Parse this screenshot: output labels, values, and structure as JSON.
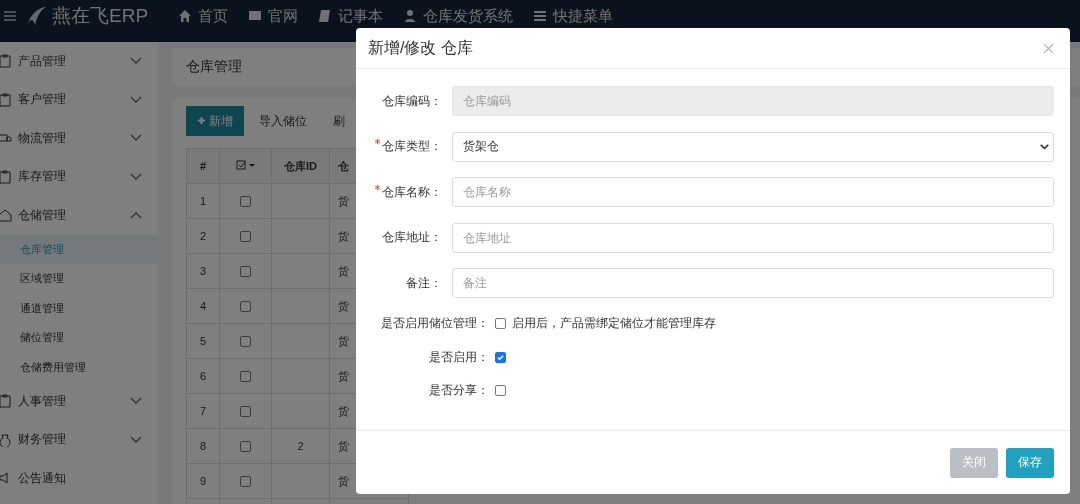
{
  "app": {
    "logo": "燕在飞ERP"
  },
  "nav": [
    {
      "label": "首页",
      "kind": "home"
    },
    {
      "label": "官网",
      "kind": "web"
    },
    {
      "label": "记事本",
      "kind": "note"
    },
    {
      "label": "仓库发货系统",
      "kind": "user"
    },
    {
      "label": "快捷菜单",
      "kind": "menu"
    }
  ],
  "sidebar": {
    "items": [
      {
        "label": "产品管理",
        "kind": "product",
        "expanded": false
      },
      {
        "label": "客户管理",
        "kind": "customer",
        "expanded": false
      },
      {
        "label": "物流管理",
        "kind": "truck",
        "expanded": false
      },
      {
        "label": "库存管理",
        "kind": "stock",
        "expanded": false
      },
      {
        "label": "仓储管理",
        "kind": "house",
        "expanded": true,
        "children": [
          {
            "label": "仓库管理",
            "selected": true
          },
          {
            "label": "区域管理",
            "selected": false
          },
          {
            "label": "通道管理",
            "selected": false
          },
          {
            "label": "储位管理",
            "selected": false
          },
          {
            "label": "仓储费用管理",
            "selected": false
          }
        ]
      },
      {
        "label": "人事管理",
        "kind": "hr",
        "expanded": false
      },
      {
        "label": "财务管理",
        "kind": "finance",
        "expanded": false
      },
      {
        "label": "公告通知",
        "kind": "notice"
      }
    ]
  },
  "page": {
    "title": "仓库管理"
  },
  "toolbar": [
    {
      "label": "新增",
      "kind": "primary"
    },
    {
      "label": "导入储位",
      "kind": "plain"
    },
    {
      "label": "刷",
      "kind": "plain"
    }
  ],
  "table": {
    "columns": [
      {
        "kind": "index",
        "label": "#"
      },
      {
        "kind": "select"
      },
      {
        "kind": "text",
        "label": "仓库ID"
      },
      {
        "kind": "text",
        "label": "仓"
      }
    ],
    "rows": [
      {
        "index": "1",
        "checked": false,
        "type": "货"
      },
      {
        "index": "2",
        "checked": false,
        "type": "货"
      },
      {
        "index": "3",
        "checked": false,
        "type": "货"
      },
      {
        "index": "4",
        "checked": false,
        "type": "货"
      },
      {
        "index": "5",
        "checked": false,
        "type": "货"
      },
      {
        "index": "6",
        "checked": false,
        "type": "货"
      },
      {
        "index": "7",
        "checked": false,
        "type": "货"
      },
      {
        "index": "8",
        "checked": false,
        "id": "2",
        "type": "货"
      },
      {
        "index": "9",
        "checked": false,
        "type": "货"
      }
    ]
  },
  "modal": {
    "title": "新增/修改 仓库",
    "fields": [
      {
        "label": "仓库编码：",
        "required": false,
        "kind": "input",
        "placeholder": "仓库编码",
        "disabled": true
      },
      {
        "label": "仓库类型：",
        "required": true,
        "kind": "select",
        "value": "货架仓"
      },
      {
        "label": "仓库名称：",
        "required": true,
        "kind": "input",
        "placeholder": "仓库名称",
        "disabled": false
      },
      {
        "label": "仓库地址：",
        "required": false,
        "kind": "input",
        "placeholder": "仓库地址",
        "disabled": false
      },
      {
        "label": "备注：",
        "required": false,
        "kind": "input",
        "placeholder": "备注",
        "disabled": false
      }
    ],
    "checks": [
      {
        "label": "是否启用储位管理：",
        "checked": false,
        "hint": "启用后，产品需绑定储位才能管理库存"
      },
      {
        "label": "是否启用：",
        "checked": true
      },
      {
        "label": "是否分享：",
        "checked": false
      }
    ],
    "buttons": [
      {
        "label": "关闭",
        "kind": "secondary"
      },
      {
        "label": "保存",
        "kind": "primary"
      }
    ]
  }
}
